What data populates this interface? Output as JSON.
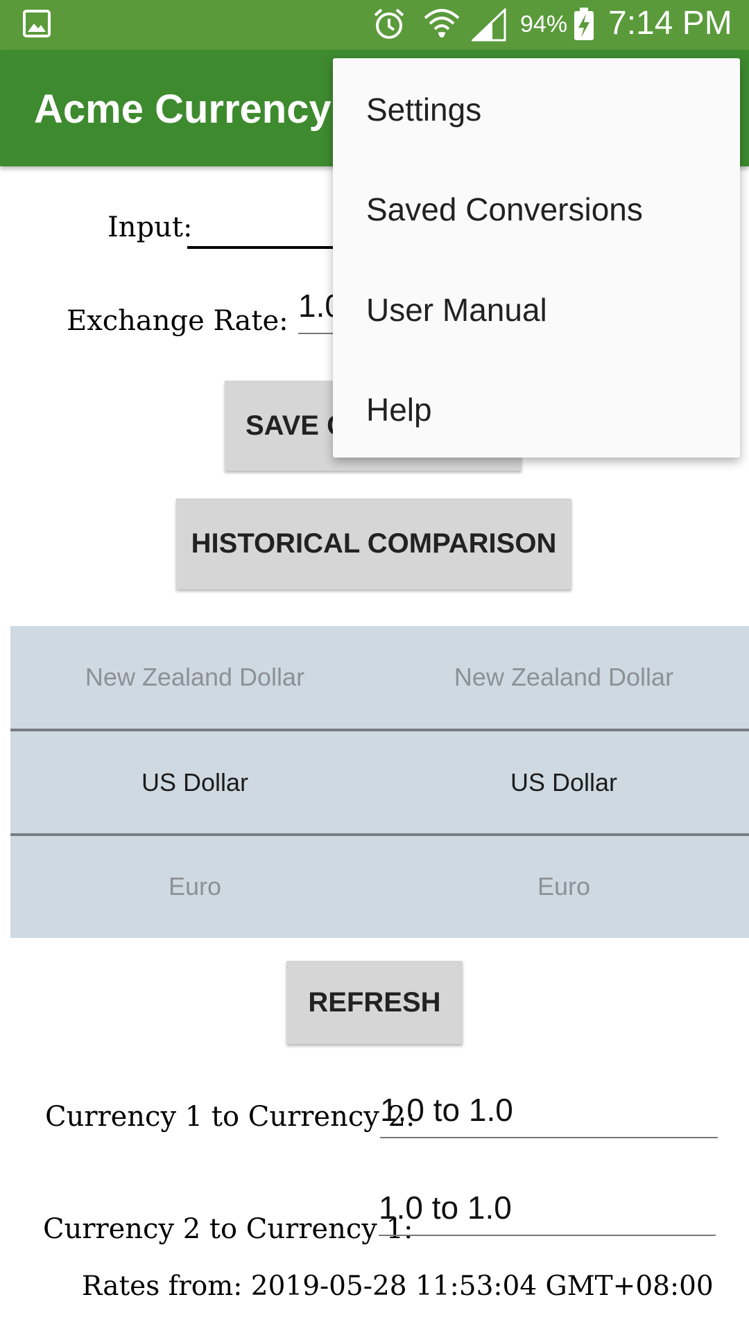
{
  "status_bar": {
    "battery": "94%",
    "time": "7:14 PM",
    "icons": [
      "gallery-icon",
      "alarm-icon",
      "wifi-icon",
      "signal-icon",
      "battery-charging-icon"
    ]
  },
  "app_bar": {
    "title": "Acme Currency C"
  },
  "form": {
    "input_label": "Input:",
    "exchange_rate_label": "Exchange Rate:",
    "exchange_rate_value": "1.0"
  },
  "buttons": {
    "save": "SAVE C",
    "historical": "HISTORICAL COMPARISON",
    "refresh": "REFRESH"
  },
  "picker": {
    "rows": [
      {
        "left": "New Zealand Dollar",
        "right": "New Zealand Dollar"
      },
      {
        "left": "US Dollar",
        "right": "US Dollar"
      },
      {
        "left": "Euro",
        "right": "Euro"
      }
    ]
  },
  "results": {
    "c1_to_c2_label": "Currency 1 to Currency 2:",
    "c1_to_c2_value": "1.0 to 1.0",
    "c2_to_c1_label": "Currency 2 to Currency 1:",
    "c2_to_c1_value": "1.0 to 1.0",
    "rates_from": "Rates from: 2019-05-28 11:53:04 GMT+08:00"
  },
  "menu": {
    "items": [
      "Settings",
      "Saved Conversions",
      "User Manual",
      "Help"
    ]
  },
  "colors": {
    "status_bar": "#5a9a3b",
    "app_bar": "#3e8a2f",
    "picker_bg": "#cfd9e2"
  }
}
